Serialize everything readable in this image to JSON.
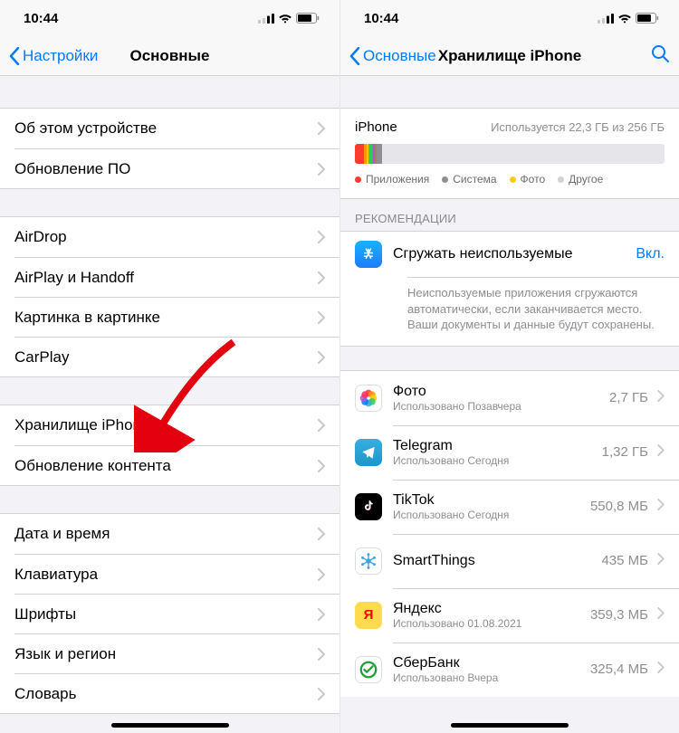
{
  "status": {
    "time": "10:44"
  },
  "left": {
    "back": "Настройки",
    "title": "Основные",
    "groups": [
      [
        "Об этом устройстве",
        "Обновление ПО"
      ],
      [
        "AirDrop",
        "AirPlay и Handoff",
        "Картинка в картинке",
        "CarPlay"
      ],
      [
        "Хранилище iPhone",
        "Обновление контента"
      ],
      [
        "Дата и время",
        "Клавиатура",
        "Шрифты",
        "Язык и регион",
        "Словарь"
      ]
    ]
  },
  "right": {
    "back": "Основные",
    "title": "Хранилище iPhone",
    "storage": {
      "device": "iPhone",
      "usage": "Используется 22,3 ГБ из 256 ГБ",
      "segments": [
        {
          "color": "#ff3b30",
          "pct": 3
        },
        {
          "color": "#ff9500",
          "pct": 0.8
        },
        {
          "color": "#ffcc00",
          "pct": 0.5
        },
        {
          "color": "#34c759",
          "pct": 1.2
        },
        {
          "color": "#30b0c7",
          "pct": 0.5
        },
        {
          "color": "#af52de",
          "pct": 0.5
        },
        {
          "color": "#a2845e",
          "pct": 0.4
        },
        {
          "color": "#8e8e93",
          "pct": 1.8
        }
      ],
      "legend": [
        {
          "color": "#ff3b30",
          "label": "Приложения"
        },
        {
          "color": "#8e8e93",
          "label": "Система"
        },
        {
          "color": "#ffcc00",
          "label": "Фото"
        },
        {
          "color": "#d1d1d6",
          "label": "Другое"
        }
      ]
    },
    "recommendations_header": "РЕКОМЕНДАЦИИ",
    "reco": {
      "title": "Сгружать неиспользуемые",
      "state": "Вкл.",
      "desc": "Неиспользуемые приложения сгружаются автоматически, если заканчивается место. Ваши документы и данные будут сохранены."
    },
    "apps": [
      {
        "name": "Фото",
        "sub": "Использовано Позавчера",
        "size": "2,7 ГБ",
        "icon": "photos"
      },
      {
        "name": "Telegram",
        "sub": "Использовано Сегодня",
        "size": "1,32 ГБ",
        "icon": "telegram"
      },
      {
        "name": "TikTok",
        "sub": "Использовано Сегодня",
        "size": "550,8 МБ",
        "icon": "tiktok"
      },
      {
        "name": "SmartThings",
        "sub": "",
        "size": "435 МБ",
        "icon": "smartthings"
      },
      {
        "name": "Яндекс",
        "sub": "Использовано 01.08.2021",
        "size": "359,3 МБ",
        "icon": "yandex"
      },
      {
        "name": "СберБанк",
        "sub": "Использовано Вчера",
        "size": "325,4 МБ",
        "icon": "sber"
      }
    ]
  }
}
